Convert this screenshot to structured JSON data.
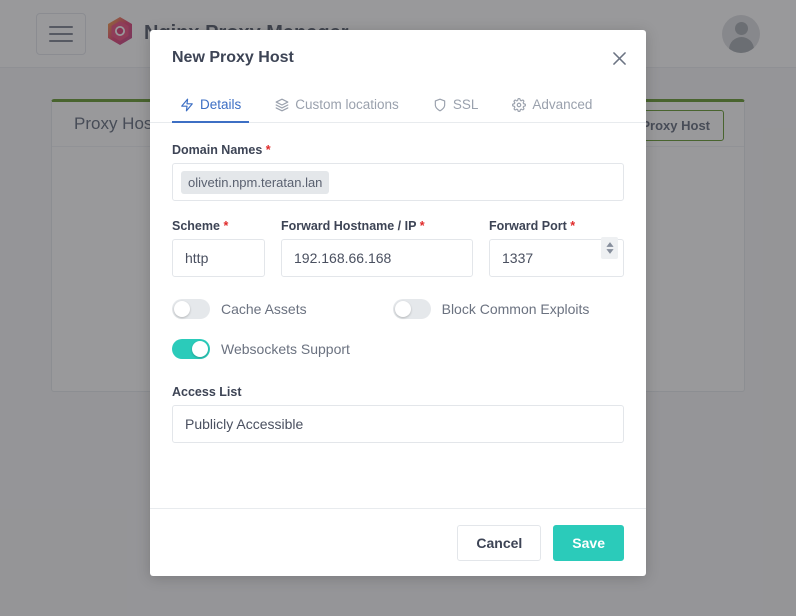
{
  "navbar": {
    "menu_icon": "hamburger-icon",
    "logo_icon": "npm-hexagon-logo",
    "brand_title": "Nginx Proxy Manager",
    "avatar_icon": "user-avatar-icon"
  },
  "background_page": {
    "card_title": "Proxy Hosts",
    "add_button_label": "Add Proxy Host",
    "accent_color": "#4f8a10"
  },
  "modal": {
    "title": "New Proxy Host",
    "close_icon": "close-icon",
    "tabs": [
      {
        "label": "Details",
        "icon": "zap-icon",
        "active": true
      },
      {
        "label": "Custom locations",
        "icon": "layers-icon",
        "active": false
      },
      {
        "label": "SSL",
        "icon": "shield-icon",
        "active": false
      },
      {
        "label": "Advanced",
        "icon": "gear-icon",
        "active": false
      }
    ],
    "active_tab_color": "#3d6fc4",
    "fields": {
      "domain_names": {
        "label": "Domain Names",
        "required_marker": "*",
        "tags": [
          "olivetin.npm.teratan.lan"
        ]
      },
      "scheme": {
        "label": "Scheme",
        "required_marker": "*",
        "value": "http"
      },
      "forward_hostname": {
        "label": "Forward Hostname / IP",
        "required_marker": "*",
        "value": "192.168.66.168"
      },
      "forward_port": {
        "label": "Forward Port",
        "required_marker": "*",
        "value": "1337",
        "stepper_icon": "stepper-up-down-icon"
      },
      "access_list": {
        "label": "Access List",
        "value": "Publicly Accessible"
      }
    },
    "toggles": [
      {
        "label": "Cache Assets",
        "on": false
      },
      {
        "label": "Block Common Exploits",
        "on": false
      },
      {
        "label": "Websockets Support",
        "on": true
      }
    ],
    "toggle_on_color": "#2bcbba",
    "footer": {
      "cancel_label": "Cancel",
      "save_label": "Save"
    }
  }
}
